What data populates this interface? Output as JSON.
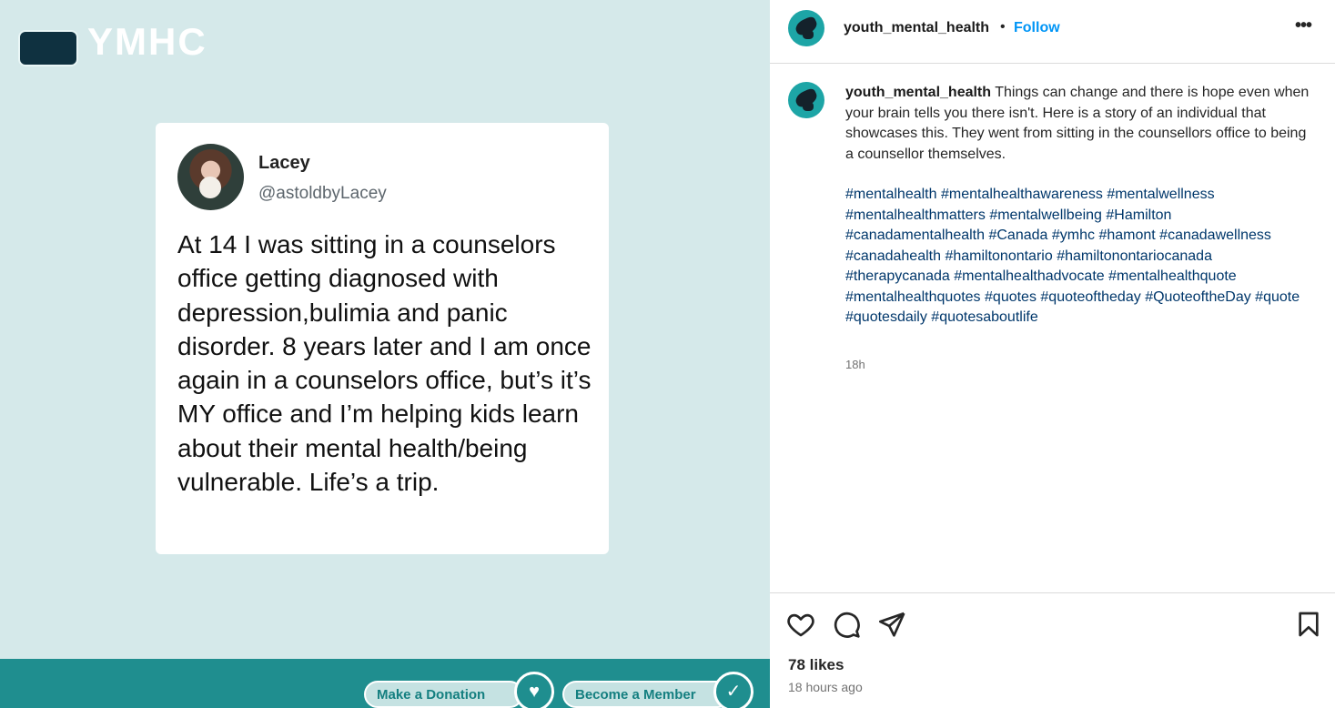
{
  "post_image": {
    "tweet": {
      "name": "Lacey",
      "handle": "@astoldbyLacey",
      "text": "At 14 I was sitting in a counselors office getting diagnosed with depression,bulimia and panic disorder. 8 years later and I am once again in a counselors office, but’s it’s MY office and I’m helping kids learn about their mental health/being vulnerable. Life’s a trip."
    },
    "banner": {
      "title": "YMHC",
      "donate_label": "Make a Donation",
      "member_label": "Become a Member",
      "color": "#1f8e8f"
    },
    "background_color": "#d5e9ea"
  },
  "header": {
    "username": "youth_mental_health",
    "separator": "•",
    "follow_label": "Follow",
    "more_label": "•••"
  },
  "caption": {
    "username": "youth_mental_health",
    "text": "Things can change and there is hope even when your brain tells you there isn't. Here is a story of an individual that showcases this. They went from sitting in the counsellors office to being a counsellor themselves.",
    "hashtags": [
      "#mentalhealth",
      "#mentalhealthawareness",
      "#mentalwellness",
      "#mentalhealthmatters",
      "#mentalwellbeing",
      "#Hamilton",
      "#canadamentalhealth",
      "#Canada",
      "#ymhc",
      "#hamont",
      "#canadawellness",
      "#canadahealth",
      "#hamiltonontario",
      "#hamiltonontariocanada",
      "#therapycanada",
      "#mentalhealthadvocate",
      "#mentalhealthquote",
      "#mentalhealthquotes",
      "#quotes",
      "#quoteoftheday",
      "#QuoteoftheDay",
      "#quote",
      "#quotesdaily",
      "#quotesaboutlife"
    ],
    "time": "18h"
  },
  "actions": {
    "icons": [
      "heart-icon",
      "comment-icon",
      "share-icon",
      "bookmark-icon"
    ],
    "likes": "78 likes",
    "posted_ago": "18 hours ago"
  },
  "colors": {
    "link": "#0095f6",
    "hashtag": "#00376b",
    "muted": "#737373"
  }
}
